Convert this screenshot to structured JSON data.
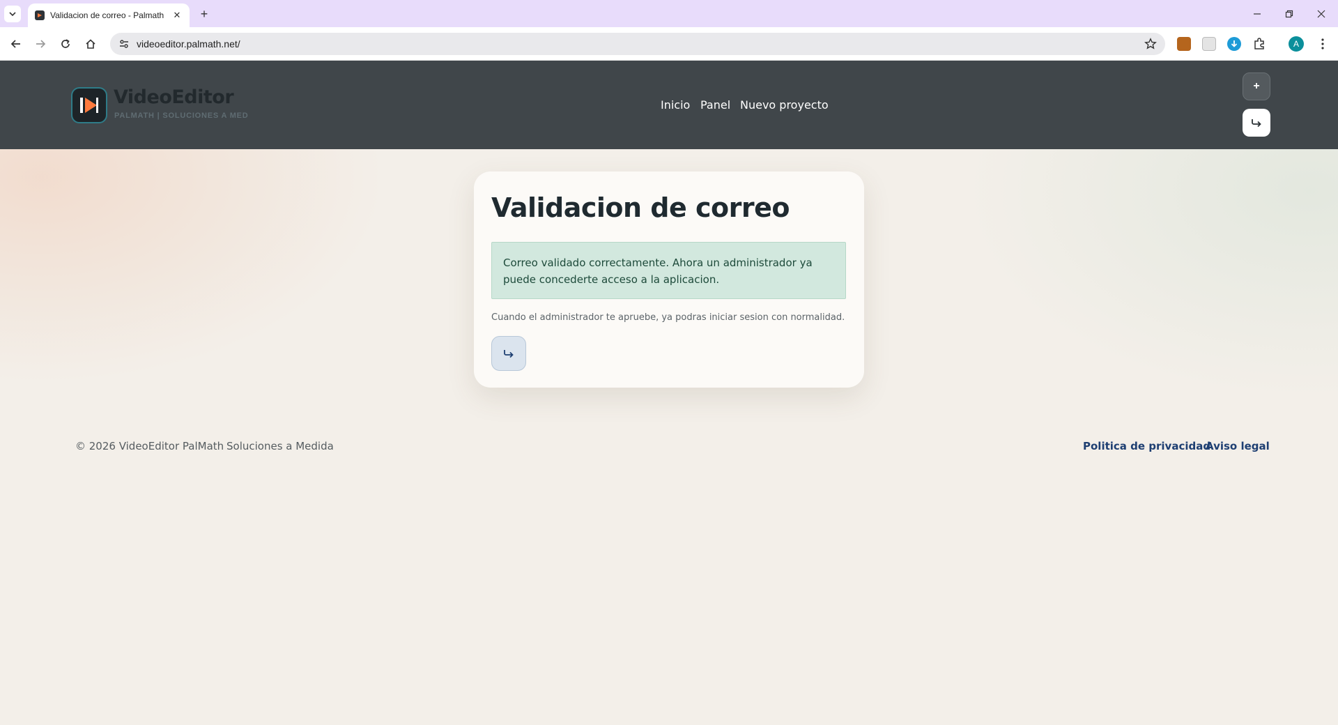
{
  "browser": {
    "tab_title": "Validacion de correo - Palmath",
    "url": "videoeditor.palmath.net/",
    "avatar_letter": "A",
    "new_tab_symbol": "+",
    "close_symbol": "✕"
  },
  "site": {
    "brand_name": "VideoEditor",
    "brand_tagline": "PALMATH | SOLUCIONES A MED",
    "nav": {
      "home": "Inicio",
      "panel": "Panel",
      "new_project": "Nuevo proyecto"
    },
    "add_button_symbol": "+"
  },
  "card": {
    "title": "Validacion de correo",
    "alert_text": "Correo validado correctamente. Ahora un administrador ya puede concederte acceso a la aplicacion.",
    "note": "Cuando el administrador te apruebe, ya podras iniciar sesion con normalidad."
  },
  "footer": {
    "copyright": "© 2026 VideoEditor PalMath",
    "subtitle": "Soluciones a Medida",
    "privacy_link": "Politica de privacidad",
    "legal_link": "Aviso legal"
  },
  "colors": {
    "header_bg": "#40464a",
    "alert_bg": "#d2e8de",
    "link": "#1e3f72",
    "tab_strip": "#e8dcfb"
  },
  "icons": [
    "tab-menu-icon",
    "favicon-icon",
    "close-icon",
    "back-icon",
    "forward-icon",
    "reload-icon",
    "home-icon",
    "site-info-icon",
    "star-icon",
    "extensions-icon",
    "menu-icon",
    "logo-icon",
    "login-icon"
  ]
}
